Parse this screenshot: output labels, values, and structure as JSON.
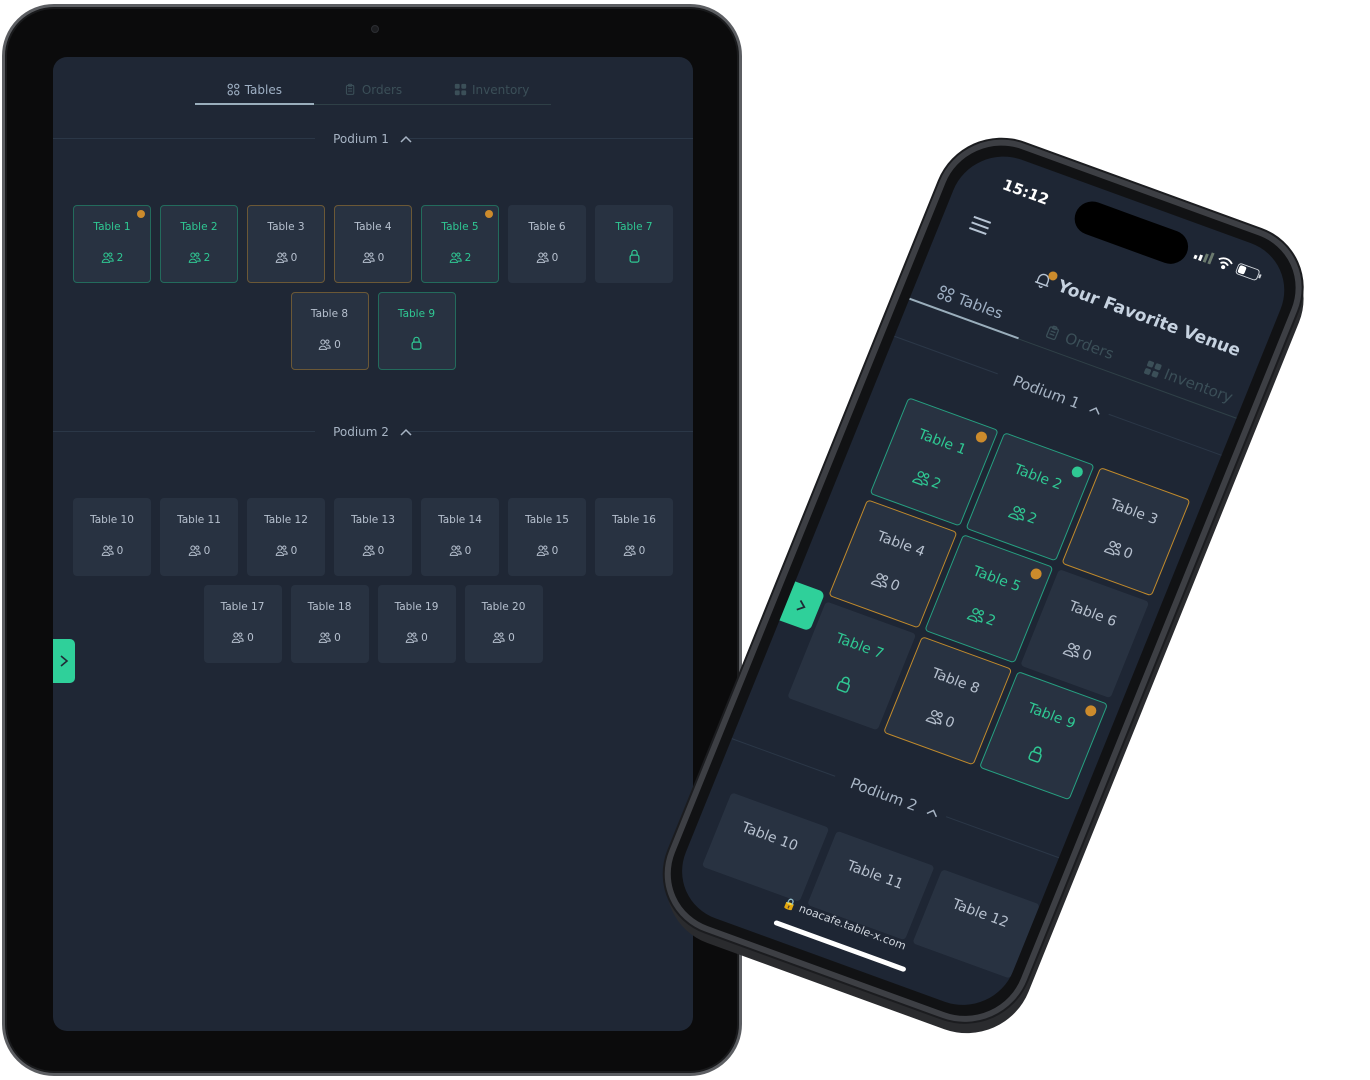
{
  "colors": {
    "screen_bg": "#1f2735",
    "card_bg": "#283241",
    "accent_green": "#2fc893",
    "accent_orange": "#cc8b2c",
    "text_muted": "#b7c1cf"
  },
  "tabs": [
    {
      "label": "Tables",
      "icon": "tables-grid-icon",
      "active": true
    },
    {
      "label": "Orders",
      "icon": "clipboard-icon",
      "active": false
    },
    {
      "label": "Inventory",
      "icon": "inventory-grid-icon",
      "active": false
    }
  ],
  "podiums": [
    {
      "label": "Podium 1",
      "expanded": true,
      "tables": [
        {
          "name": "Table 1",
          "guests": "2",
          "status": "occupied",
          "border": "green",
          "text": "green",
          "dot": "orange",
          "locked": false
        },
        {
          "name": "Table 2",
          "guests": "2",
          "status": "occupied",
          "border": "green",
          "text": "green",
          "dot": "teal",
          "locked": false
        },
        {
          "name": "Table 3",
          "guests": "0",
          "status": "reserved",
          "border": "orange",
          "text": "default",
          "dot": null,
          "locked": false
        },
        {
          "name": "Table 4",
          "guests": "0",
          "status": "reserved",
          "border": "orange",
          "text": "default",
          "dot": null,
          "locked": false
        },
        {
          "name": "Table 5",
          "guests": "2",
          "status": "occupied",
          "border": "green",
          "text": "green",
          "dot": "orange",
          "locked": false
        },
        {
          "name": "Table 6",
          "guests": "0",
          "status": "free",
          "border": "none",
          "text": "default",
          "dot": null,
          "locked": false
        },
        {
          "name": "Table 7",
          "guests": null,
          "status": "locked",
          "border": "none",
          "text": "green",
          "dot": null,
          "locked": true
        },
        {
          "name": "Table 8",
          "guests": "0",
          "status": "reserved",
          "border": "orange",
          "text": "default",
          "dot": null,
          "locked": false
        },
        {
          "name": "Table 9",
          "guests": null,
          "status": "locked",
          "border": "green",
          "text": "green",
          "dot": "orange",
          "locked": true
        }
      ]
    },
    {
      "label": "Podium 2",
      "expanded": true,
      "tables": [
        {
          "name": "Table 10",
          "guests": "0"
        },
        {
          "name": "Table 11",
          "guests": "0"
        },
        {
          "name": "Table 12",
          "guests": "0"
        },
        {
          "name": "Table 13",
          "guests": "0"
        },
        {
          "name": "Table 14",
          "guests": "0"
        },
        {
          "name": "Table 15",
          "guests": "0"
        },
        {
          "name": "Table 16",
          "guests": "0"
        },
        {
          "name": "Table 17",
          "guests": "0"
        },
        {
          "name": "Table 18",
          "guests": "0"
        },
        {
          "name": "Table 19",
          "guests": "0"
        },
        {
          "name": "Table 20",
          "guests": "0"
        }
      ]
    }
  ],
  "phone": {
    "status_time": "15:12",
    "venue_name": "Your Favorite Venue",
    "url": "noacafe.table-x.com"
  }
}
